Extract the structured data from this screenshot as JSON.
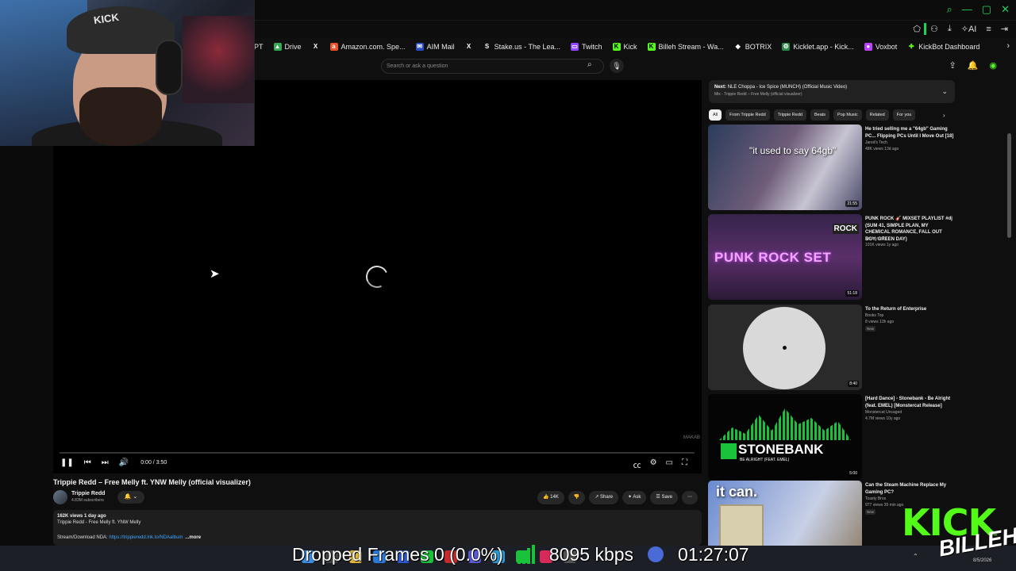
{
  "bookmarks": [
    {
      "label": "PT",
      "color": ""
    },
    {
      "label": "Drive",
      "color": "#34a853"
    },
    {
      "label": "",
      "icon": "x-icon",
      "color": "#000000"
    },
    {
      "label": "Amazon.com. Spe...",
      "color": "#e8522c"
    },
    {
      "label": "AIM Mail",
      "color": "#2a4cc6"
    },
    {
      "label": "",
      "icon": "x-icon",
      "color": "#000000"
    },
    {
      "label": "Stake.us - The Lea...",
      "color": "#1a2c38"
    },
    {
      "label": "Twitch",
      "color": "#9146ff"
    },
    {
      "label": "Kick",
      "color": "#53fc18"
    },
    {
      "label": "Billeh Stream - Wa...",
      "color": "#53fc18"
    },
    {
      "label": "BOTRIX",
      "color": "#444444"
    },
    {
      "label": "Kicklet.app - Kick...",
      "color": "#2a8a4a"
    },
    {
      "label": "Voxbot",
      "color": "#c040ff"
    },
    {
      "label": "KickBot Dashboard",
      "color": "#53fc18"
    }
  ],
  "search": {
    "placeholder": "Search or ask a question"
  },
  "player": {
    "time": "0:00 / 3:50",
    "watermark": "MAKAB"
  },
  "video": {
    "title": "Trippie Redd – Free Melly ft. YNW Melly (official visualizer)",
    "channel": "Trippie Redd",
    "subscribers": "4.83M subscribers",
    "likes": "14K",
    "share": "Share",
    "ask": "Ask",
    "save": "Save",
    "stats": "162K views  1 day ago",
    "desc_line": "Trippie Redd - Free Melly ft. YNW Melly",
    "desc_link_prefix": "Stream/Download NDA: ",
    "desc_link": "https://trippieredd.lnk.to/NDAalbum",
    "more": "...more"
  },
  "next_up": {
    "label": "Next:",
    "title": "NLE Choppa - Ice Spice (MUNCH) (Official Music Video)",
    "sub": "Mix - Trippie Redd – Free Melly (official visualizer)"
  },
  "chips": [
    "All",
    "From Trippie Redd",
    "Trippie Redd",
    "Beats",
    "Pop Music",
    "Related",
    "For you"
  ],
  "recommendations": [
    {
      "title": "He tried selling me a \"64gb\" Gaming PC... Flipping PCs Until I Move Out [18]",
      "channel": "Jared's Tech",
      "meta": "48K views  13d ago",
      "duration": "21:55",
      "thumb_text": "\"it used to say 64gb\""
    },
    {
      "title": "PUNK ROCK 🎸 MIXSET PLAYLIST #dj (SUM 41, SIMPLE PLAN, MY CHEMICAL ROMANCE, FALL OUT BOY, GREEN DAY)",
      "channel": "KeonardoZz",
      "meta": "101K views  1y ago",
      "duration": "51:18",
      "thumb_text": "PUNK ROCK SET",
      "thumb_badge": "ROCK"
    },
    {
      "title": "To the Return of Enterprise",
      "channel": "Books Top",
      "meta": "8 views  13h ago",
      "badge": "New",
      "duration": "8:40"
    },
    {
      "title": "[Hard Dance] - Stonebank - Be Alright (feat. EMEL) [Monstercat Release]",
      "channel": "Monstercat Uncaged",
      "meta": "4.7M views  10y ago",
      "duration": "5:00",
      "thumb_text": "STONEBANK",
      "thumb_sub": "BE ALRIGHT (FEAT. EMEL)"
    },
    {
      "title": "Can the Steam Machine Replace My Gaming PC?",
      "channel": "Toasty Bros",
      "meta": "977 views  39 min ago",
      "badge": "New",
      "thumb_text": "it can."
    }
  ],
  "overlay": {
    "dropped": "Dropped Frames 0 (0.0%)",
    "bitrate": "8095 kbps",
    "uptime": "01:27:07"
  },
  "webcam": {
    "cap_logo": "KICK"
  },
  "kick_logo": "KICK",
  "kick_signature": "BILLEH",
  "taskbar": {
    "date": "8/5/2026"
  },
  "colors": {
    "accent": "#53fc18",
    "browser_green": "#20d25c",
    "link": "#3ea6ff"
  }
}
